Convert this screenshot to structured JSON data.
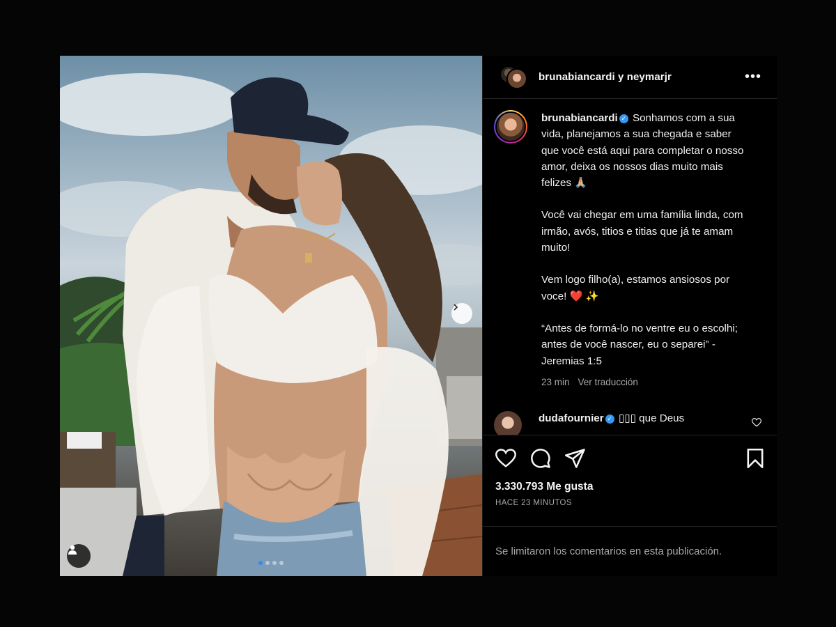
{
  "post": {
    "header_title": "brunabiancardi y neymarjr",
    "more_icon": "more-horizontal-icon"
  },
  "caption": {
    "username": "brunabiancardi",
    "lines": [
      "Sonhamos com a sua vida, planejamos a sua chegada e saber que você está aqui para completar o nosso amor, deixa os nossos dias muito mais felizes 🙏🏼",
      "Você vai chegar em uma família linda, com irmão, avós, titios e titias que já te amam muito!",
      "Vem logo filho(a), estamos ansiosos por voce! ❤️ ✨",
      "“Antes de formá-lo no ventre eu o escolhi; antes de você nascer, eu o separei” - Jeremias 1:5"
    ],
    "time": "23 min",
    "translate": "Ver traducción"
  },
  "comment": {
    "username": "dudafournier",
    "text": "▯▯▯ que Deus"
  },
  "likes": "3.330.793 Me gusta",
  "timestamp": "HACE 23 MINUTOS",
  "comments_limited": "Se limitaron los comentarios en esta publicación.",
  "carousel": {
    "slide": 1,
    "total": 4
  },
  "colors": {
    "background": "#050505",
    "panel": "#000000",
    "verified": "#3897f0",
    "active_dot": "#2f8cf5"
  }
}
